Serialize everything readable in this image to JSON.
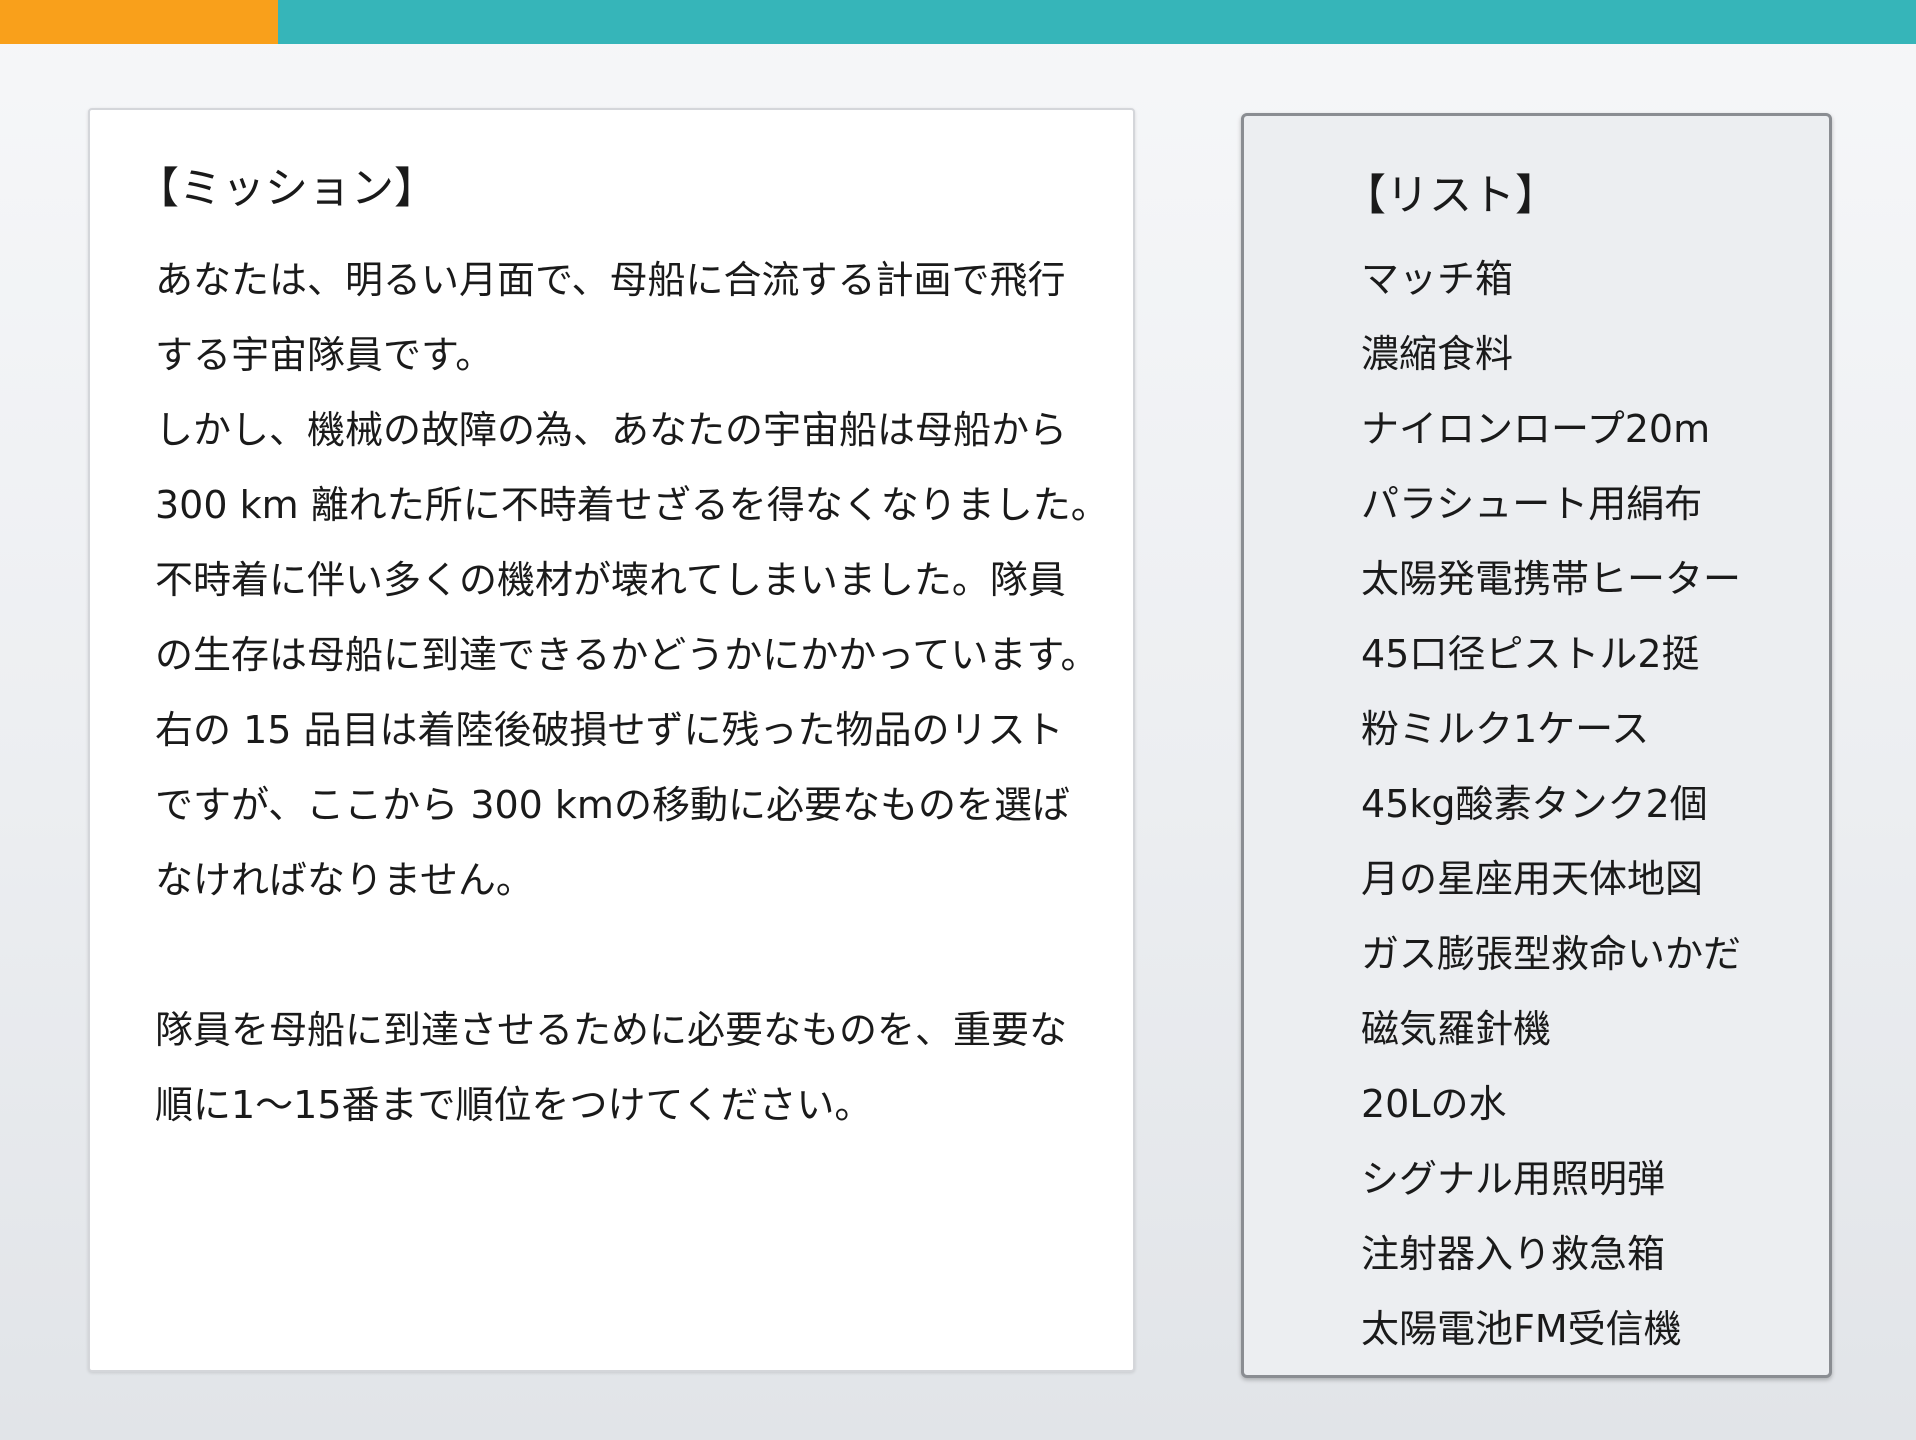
{
  "colors": {
    "top_accent": "#f9a01b",
    "top_band": "#36b5b9",
    "panel_border": "#8a8d92"
  },
  "mission": {
    "title": "【ミッション】",
    "lines": [
      "あなたは、明るい月面で、母船に合流する計画で飛行",
      "する宇宙隊員です。",
      "しかし、機械の故障の為、あなたの宇宙船は母船から",
      "300 km 離れた所に不時着せざるを得なくなりました。",
      "不時着に伴い多くの機材が壊れてしまいました。隊員",
      "の生存は母船に到達できるかどうかにかかっています。",
      "右の 15 品目は着陸後破損せずに残った物品のリスト",
      "ですが、ここから 300 kmの移動に必要なものを選ば",
      "なければなりません。",
      "隊員を母船に到達させるために必要なものを、重要な",
      "順に1〜15番まで順位をつけてください。"
    ]
  },
  "list": {
    "title": "【リスト】",
    "items": [
      "マッチ箱",
      "濃縮食料",
      "ナイロンロープ20m",
      "パラシュート用絹布",
      "太陽発電携帯ヒーター",
      "45口径ピストル2挺",
      "粉ミルク1ケース",
      "45kg酸素タンク2個",
      "月の星座用天体地図",
      "ガス膨張型救命いかだ",
      "磁気羅針機",
      "20Lの水",
      "シグナル用照明弾",
      "注射器入り救急箱",
      "太陽電池FM受信機"
    ]
  }
}
